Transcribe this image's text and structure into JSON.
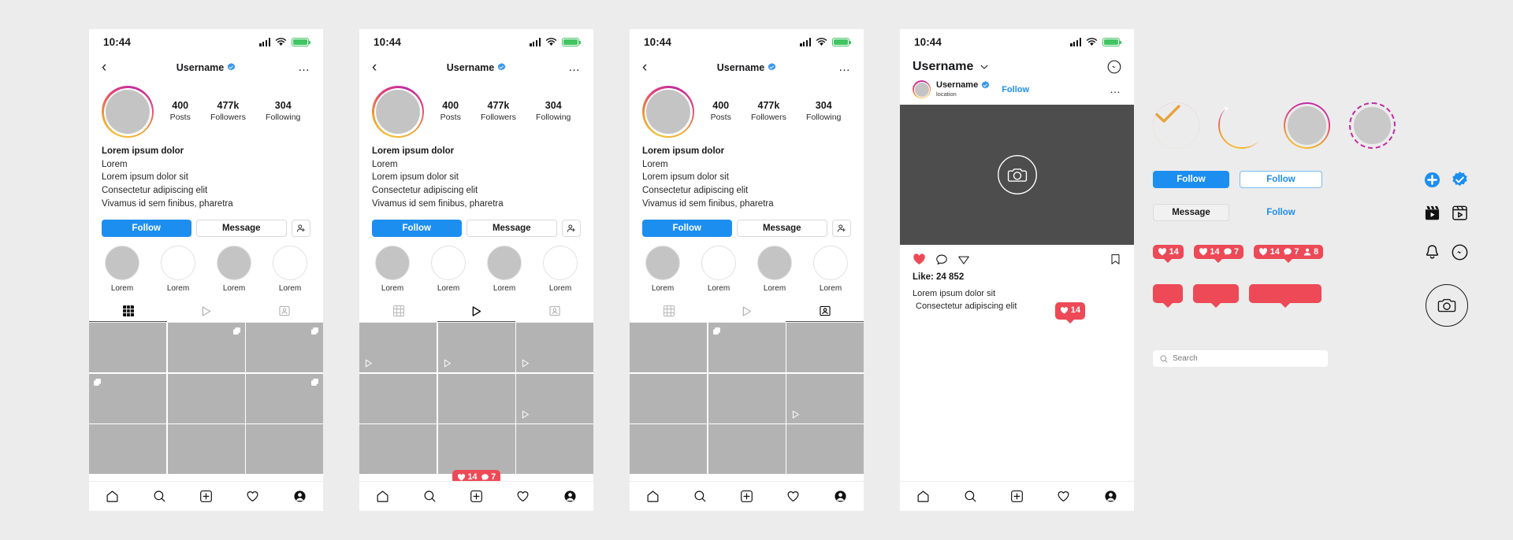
{
  "meta": {
    "accent_blue": "#1c8ef0",
    "accent_red": "#ed4956",
    "verified_blue": "#3897f0",
    "ring_pink": "#c32aa3",
    "ring_yellow": "#f5c13b",
    "photo_gray": "#4d4d4d"
  },
  "status_bar": {
    "time": "10:44",
    "signal_icon": "cellular-signal-icon",
    "wifi_icon": "wifi-icon",
    "battery_icon": "battery-icon"
  },
  "profile": {
    "back_icon": "chevron-left-icon",
    "username": "Username",
    "verified_icon": "verified-badge-icon",
    "more_icon": "more-options-icon",
    "stats": [
      {
        "number": "400",
        "label": "Posts"
      },
      {
        "number": "477k",
        "label": "Followers"
      },
      {
        "number": "304",
        "label": "Following"
      }
    ],
    "bio": {
      "name": "Lorem ipsum dolor",
      "lines": [
        "Lorem",
        "Lorem ipsum dolor sit",
        "Consectetur adipiscing elit",
        "Vivamus id sem finibus, pharetra"
      ]
    },
    "actions": {
      "follow": "Follow",
      "message": "Message",
      "suggest_icon": "add-person-icon"
    },
    "highlights": [
      {
        "label": "Lorem",
        "filled": true
      },
      {
        "label": "Lorem",
        "filled": false
      },
      {
        "label": "Lorem",
        "filled": true
      },
      {
        "label": "Lorem",
        "filled": false
      }
    ],
    "tabs": [
      {
        "name": "grid",
        "icon": "grid-icon"
      },
      {
        "name": "reels",
        "icon": "play-icon"
      },
      {
        "name": "tagged",
        "icon": "tagged-person-icon"
      }
    ]
  },
  "phones": {
    "one": {
      "active_tab": "grid"
    },
    "two": {
      "active_tab": "reels"
    },
    "three": {
      "active_tab": "tagged"
    }
  },
  "bottom_nav": [
    {
      "icon": "home-icon",
      "name": "home"
    },
    {
      "icon": "search-icon",
      "name": "search"
    },
    {
      "icon": "add-post-icon",
      "name": "create"
    },
    {
      "icon": "heart-icon",
      "name": "activity"
    },
    {
      "icon": "profile-icon",
      "name": "profile"
    }
  ],
  "feed": {
    "header_title": "Username",
    "chevron_icon": "chevron-down-icon",
    "messenger_icon": "messenger-icon",
    "post": {
      "username": "Username",
      "verified_icon": "verified-badge-icon",
      "location": "location",
      "follow": "Follow",
      "more_icon": "more-options-icon",
      "photo_icon": "camera-placeholder-icon",
      "actions": {
        "like_icon": "heart-filled-icon",
        "comment_icon": "comment-icon",
        "share_icon": "share-icon",
        "save_icon": "bookmark-icon"
      },
      "likes": "Like: 24 852",
      "caption_line1": "Lorem ipsum dolor sit",
      "caption_line2": "Consectetur adipiscing elit",
      "badge_count": "14"
    }
  },
  "components": {
    "rings": [
      {
        "name": "ring-check",
        "style": "check"
      },
      {
        "name": "ring-plus",
        "style": "plus"
      },
      {
        "name": "ring-plain",
        "style": "plain"
      },
      {
        "name": "ring-dashed",
        "style": "dashed"
      }
    ],
    "buttons": {
      "follow_solid": "Follow",
      "follow_outline": "Follow",
      "message": "Message",
      "follow_text": "Follow"
    },
    "icons": {
      "plus_circle": "plus-circle-icon",
      "verified": "verified-badge-icon",
      "reels_filled": "reels-filled-icon",
      "reels_outline": "reels-outline-icon",
      "bell": "notification-bell-icon",
      "messenger": "messenger-icon",
      "camera": "camera-circle-icon"
    },
    "badges": [
      {
        "name": "likes-badge",
        "items": [
          {
            "icon": "heart-icon",
            "count": "14"
          }
        ]
      },
      {
        "name": "likes-comments-badge",
        "items": [
          {
            "icon": "heart-icon",
            "count": "14"
          },
          {
            "icon": "comment-icon",
            "count": "7"
          }
        ]
      },
      {
        "name": "full-stats-badge",
        "items": [
          {
            "icon": "heart-icon",
            "count": "14"
          },
          {
            "icon": "comment-icon",
            "count": "7"
          },
          {
            "icon": "person-icon",
            "count": "8"
          }
        ]
      }
    ],
    "search": {
      "placeholder": "Search",
      "icon": "search-icon"
    }
  }
}
